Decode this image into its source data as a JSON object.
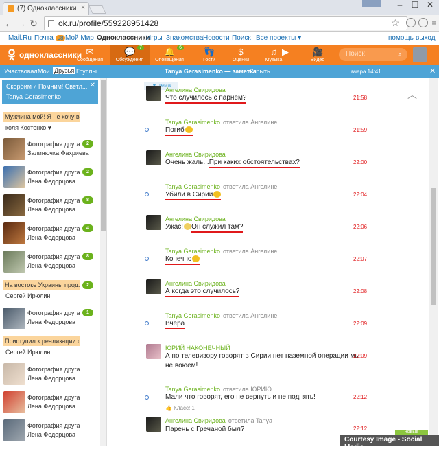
{
  "browser": {
    "tab_title": "(7) Одноклассники",
    "tab_close": "×",
    "url": "ok.ru/profile/559228951428",
    "window_buttons": [
      "–",
      "☐",
      "✕"
    ]
  },
  "portal_bar": {
    "links": [
      "Mail.Ru",
      "Почта",
      "Мой Мир",
      "Одноклассники",
      "Игры",
      "Знакомства",
      "Новости",
      "Поиск",
      "Все проекты ▾"
    ],
    "mail_count": "98",
    "help": "помощь",
    "logout": "выход"
  },
  "header": {
    "logo_text": "одноклассники",
    "nav": [
      {
        "label": "Сообщения",
        "badge": ""
      },
      {
        "label": "Обсуждения",
        "badge": "7"
      },
      {
        "label": "Оповещения",
        "badge": "6"
      },
      {
        "label": "Гости",
        "badge": ""
      },
      {
        "label": "Оценки",
        "badge": ""
      },
      {
        "label": "Музыка",
        "badge": ""
      },
      {
        "label": "Видео",
        "badge": ""
      }
    ],
    "search_placeholder": "Поиск"
  },
  "subheader": {
    "filters": [
      "Участвовал",
      "Мои",
      "Друзья",
      "Группы"
    ],
    "title": "Tanya Gerasimenko — заметка",
    "hide": "Скрыть",
    "time": "вчера 14:41",
    "close": "✕"
  },
  "sidebar": {
    "condolence_title": "Скорбим и Помним! Светл...",
    "condolence_author": "Tanya Gerasimenko",
    "items": [
      {
        "kind": "topic",
        "title": "Мужчина мой! Я не хочу в...",
        "author": "коля Костенко ♥"
      },
      {
        "kind": "photo",
        "title": "Фотография друга",
        "sub": "Залинючка Фахриева",
        "badge": "2"
      },
      {
        "kind": "photo",
        "title": "Фотография друга",
        "sub": "Лена Федорцова",
        "badge": "2"
      },
      {
        "kind": "photo",
        "title": "Фотография друга",
        "sub": "Лена Федорцова",
        "badge": "8"
      },
      {
        "kind": "photo",
        "title": "Фотография друга",
        "sub": "Лена Федорцова",
        "badge": "4"
      },
      {
        "kind": "photo",
        "title": "Фотография друга",
        "sub": "Лена Федорцова",
        "badge": "8"
      },
      {
        "kind": "topic",
        "title": "На востоке Украины прод...",
        "author": "Сергей Ирюлин",
        "badge": "2"
      },
      {
        "kind": "photo",
        "title": "Фотография друга",
        "sub": "Лена Федорцова",
        "badge": "1"
      },
      {
        "kind": "topic",
        "title": "Приступил к реализации с...",
        "author": "Сергей Ирюлин"
      },
      {
        "kind": "photo",
        "title": "Фотография друга",
        "sub": "Лена Федорцова"
      },
      {
        "kind": "photo",
        "title": "Фотография друга",
        "sub": "Лена Федорцова"
      },
      {
        "kind": "photo",
        "title": "Фотография друга",
        "sub": "Лена Федорцова"
      }
    ]
  },
  "chat": {
    "topic_button": "тема",
    "messages": [
      {
        "author": "Ангелина Свиридова",
        "reply": "",
        "text": "Что случилось с парнем?",
        "time": "21:58"
      },
      {
        "author": "Tanya Gerasimenko",
        "reply": "ответила Ангелине",
        "text": "Погиб",
        "time": "21:59"
      },
      {
        "author": "Ангелина Свиридова",
        "reply": "",
        "text": "Очень жаль...",
        "text2": "При каких обстоятельствах?",
        "time": "22:00"
      },
      {
        "author": "Tanya Gerasimenko",
        "reply": "ответила Ангелине",
        "text": "Убили в Сирии",
        "time": "22:04"
      },
      {
        "author": "Ангелина Свиридова",
        "reply": "",
        "text": "Ужас!",
        "text2": "Он служил там?",
        "time": "22:06"
      },
      {
        "author": "Tanya Gerasimenko",
        "reply": "ответила Ангелине",
        "text": "Конечно",
        "time": "22:07"
      },
      {
        "author": "Ангелина Свиридова",
        "reply": "",
        "text": "А когда это случилось?",
        "time": "22:08"
      },
      {
        "author": "Tanya Gerasimenko",
        "reply": "ответила Ангелине",
        "text": "Вчера",
        "time": "22:09"
      },
      {
        "author": "ЮРИЙ НАКОНЕЧНЫЙ",
        "reply": "",
        "text": "А по телевизору говорят в Сирии нет наземной операции мы",
        "text2": "не воюем!",
        "time": "22:09"
      },
      {
        "author": "Tanya Gerasimenko",
        "reply": "ответила ЮРИЮ",
        "text": "Мали что говорят,  его не вернуть и не поднять!",
        "time": "22:12"
      },
      {
        "author": "Ангелина Свиридова",
        "reply": "ответила Tanya",
        "text": "Парень с Гречаной был?",
        "time": "22:12"
      }
    ],
    "like": "👍 Класс! 1",
    "new_button": "новые"
  },
  "credit": "Courtesy Image - Social Media"
}
